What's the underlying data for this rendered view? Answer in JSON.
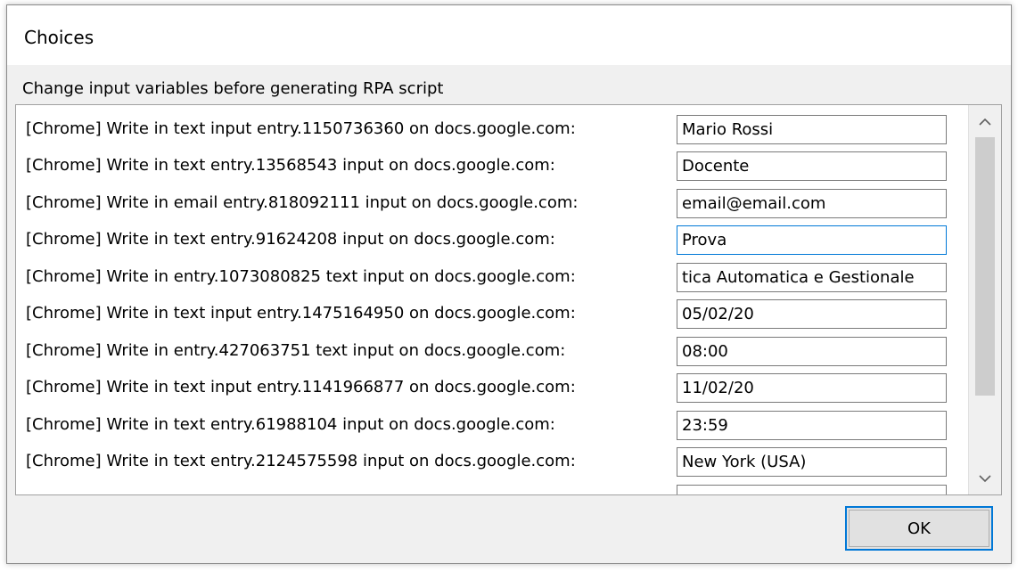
{
  "dialog": {
    "title": "Choices",
    "instruction": "Change input variables before generating RPA script",
    "ok_label": "OK"
  },
  "rows": [
    {
      "label": "[Chrome] Write in text input entry.1150736360 on docs.google.com:",
      "value": "Mario Rossi"
    },
    {
      "label": "[Chrome] Write in text entry.13568543 input on docs.google.com:",
      "value": "Docente"
    },
    {
      "label": "[Chrome] Write in email entry.818092111 input on docs.google.com:",
      "value": "email@email.com"
    },
    {
      "label": "[Chrome] Write in text entry.91624208 input on docs.google.com:",
      "value": "Prova"
    },
    {
      "label": "[Chrome] Write in entry.1073080825 text input on docs.google.com:",
      "value": "tica Automatica e Gestionale"
    },
    {
      "label": "[Chrome] Write in text input entry.1475164950 on docs.google.com:",
      "value": "05/02/20"
    },
    {
      "label": "[Chrome] Write in entry.427063751 text input on docs.google.com:",
      "value": "08:00"
    },
    {
      "label": "[Chrome] Write in text input entry.1141966877 on docs.google.com:",
      "value": "11/02/20"
    },
    {
      "label": "[Chrome] Write in text entry.61988104 input on docs.google.com:",
      "value": "23:59"
    },
    {
      "label": "[Chrome] Write in text entry.2124575598 input on docs.google.com:",
      "value": "New York (USA)"
    }
  ],
  "scrollbar": {
    "up_icon": "chevron-up-icon",
    "down_icon": "chevron-down-icon"
  },
  "colors": {
    "accent": "#0078d7",
    "dialog_bg": "#f0f0f0"
  }
}
